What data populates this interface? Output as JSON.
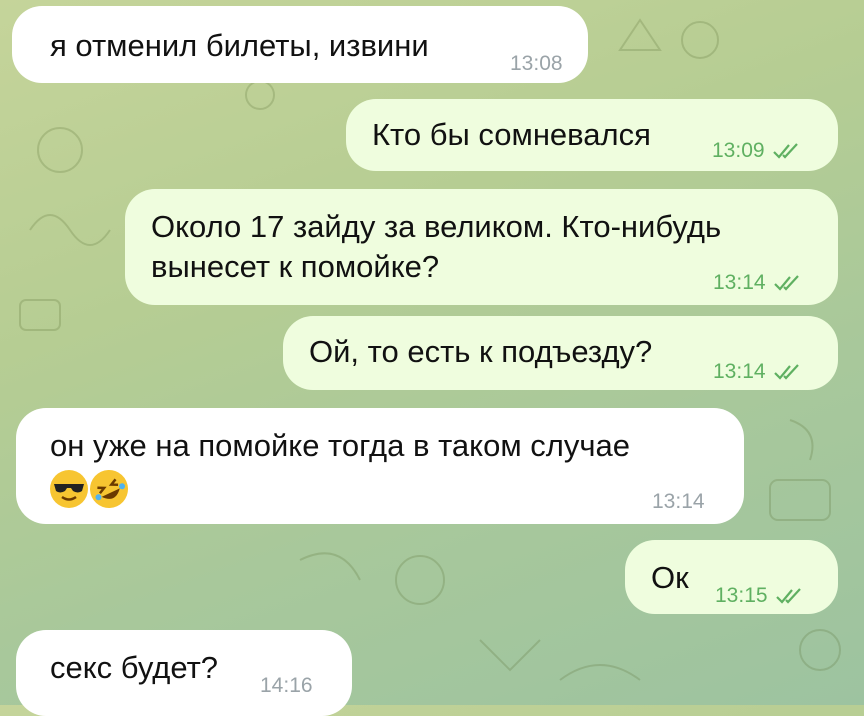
{
  "messages": [
    {
      "text": "я отменил билеты, извини",
      "time": "13:08",
      "dir": "in"
    },
    {
      "text": "Кто бы сомневался",
      "time": "13:09",
      "dir": "out",
      "read": true
    },
    {
      "lines": [
        "Около 17 зайду за великом. Кто-нибудь",
        "вынесет к помойке?"
      ],
      "time": "13:14",
      "dir": "out",
      "read": true
    },
    {
      "text": "Ой, то есть к подъезду?",
      "time": "13:14",
      "dir": "out",
      "read": true
    },
    {
      "text": "он уже на помойке тогда в таком случае",
      "emojis": [
        "sunglasses-face-emoji",
        "rolling-laughing-face-emoji"
      ],
      "time": "13:14",
      "dir": "in"
    },
    {
      "text": "Ок",
      "time": "13:15",
      "dir": "out",
      "read": true
    },
    {
      "text": "секс будет?",
      "time": "14:16",
      "dir": "in"
    }
  ],
  "colors": {
    "incoming_bubble": "#ffffff",
    "outgoing_bubble": "#effdde",
    "outgoing_meta": "#5fb061",
    "incoming_meta": "#9aa3a8"
  },
  "icons": {
    "read_receipt": "double-check-icon"
  }
}
